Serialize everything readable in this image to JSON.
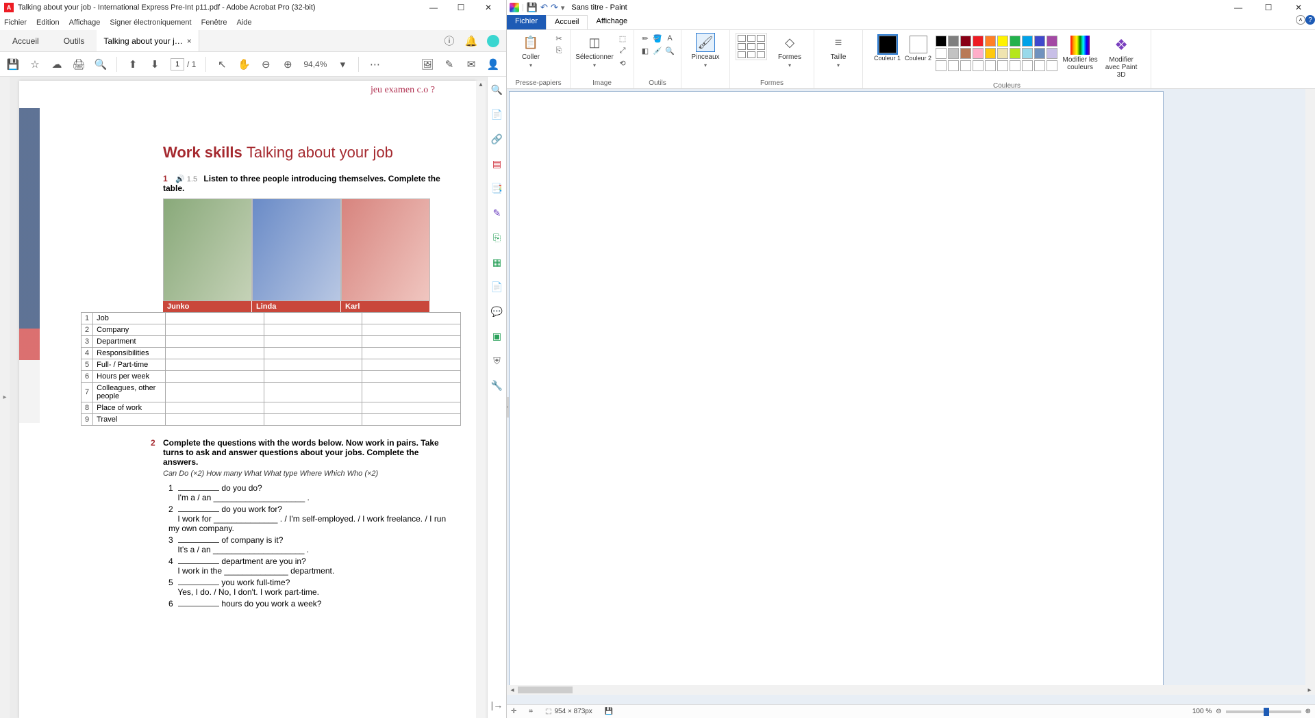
{
  "acrobat": {
    "title": "Talking about your job - International Express Pre-Int p11.pdf - Adobe Acrobat Pro (32-bit)",
    "menu": [
      "Fichier",
      "Edition",
      "Affichage",
      "Signer électroniquement",
      "Fenêtre",
      "Aide"
    ],
    "tabs": {
      "home": "Accueil",
      "tools": "Outils",
      "doc": "Talking about your j…",
      "close": "×"
    },
    "page_current": "1",
    "page_total": "/ 1",
    "zoom": "94,4%",
    "doc": {
      "handnote": "jeu examen  c.o  ?",
      "heading_bold": "Work skills",
      "heading_light": "Talking about your job",
      "ex1_num": "1",
      "ex1_audio": "🔊 1.5",
      "ex1_text": "Listen to three people introducing themselves. Complete the table.",
      "names": [
        "Junko",
        "Linda",
        "Karl"
      ],
      "rows": [
        {
          "n": "1",
          "l": "Job"
        },
        {
          "n": "2",
          "l": "Company"
        },
        {
          "n": "3",
          "l": "Department"
        },
        {
          "n": "4",
          "l": "Responsibilities"
        },
        {
          "n": "5",
          "l": "Full- / Part-time"
        },
        {
          "n": "6",
          "l": "Hours per week"
        },
        {
          "n": "7",
          "l": "Colleagues, other people"
        },
        {
          "n": "8",
          "l": "Place of work"
        },
        {
          "n": "9",
          "l": "Travel"
        }
      ],
      "ex2_num": "2",
      "ex2_text": "Complete the questions with the words below. Now work in pairs. Take turns to ask and answer questions about your jobs. Complete the answers.",
      "wordbank": "Can   Do (×2)   How many   What   What type   Where   Which   Who (×2)",
      "qa": [
        {
          "n": "1",
          "q": " do you do?",
          "a": "I'm a / an ____________________ ."
        },
        {
          "n": "2",
          "q": " do you work for?",
          "a": "I work for ______________ . / I'm self-employed. / I work freelance. / I run my own company."
        },
        {
          "n": "3",
          "q": " of company is it?",
          "a": "It's a / an ____________________ ."
        },
        {
          "n": "4",
          "q": " department are you in?",
          "a": "I work in the ______________ department."
        },
        {
          "n": "5",
          "q": " you work full-time?",
          "a": "Yes, I do. / No, I don't. I work part-time."
        },
        {
          "n": "6",
          "q": " hours do you work a week?",
          "a": ""
        }
      ]
    }
  },
  "paint": {
    "title": "Sans titre - Paint",
    "tabs": {
      "file": "Fichier",
      "home": "Accueil",
      "view": "Affichage"
    },
    "groups": {
      "clipboard": {
        "paste": "Coller",
        "label": "Presse-papiers"
      },
      "image": {
        "select": "Sélectionner",
        "label": "Image"
      },
      "tools": {
        "label": "Outils"
      },
      "brushes": {
        "btn": "Pinceaux"
      },
      "shapes": {
        "btn": "Formes",
        "label": "Formes"
      },
      "size": {
        "btn": "Taille"
      },
      "colors": {
        "c1": "Couleur 1",
        "c2": "Couleur 2",
        "edit": "Modifier les couleurs",
        "p3d": "Modifier avec Paint 3D",
        "label": "Couleurs"
      }
    },
    "palette": [
      "#000",
      "#7f7f7f",
      "#880015",
      "#ed1c24",
      "#ff7f27",
      "#fff200",
      "#22b14c",
      "#00a2e8",
      "#3f48cc",
      "#a349a4",
      "#fff",
      "#c3c3c3",
      "#b97a57",
      "#ffaec9",
      "#ffc90e",
      "#efe4b0",
      "#b5e61d",
      "#99d9ea",
      "#7092be",
      "#c8bfe7",
      "#fff",
      "#fff",
      "#fff",
      "#fff",
      "#fff",
      "#fff",
      "#fff",
      "#fff",
      "#fff",
      "#fff"
    ],
    "status": {
      "cross": "✛",
      "dims_icon": "⌗",
      "dims": "954 × 873px",
      "size_icon": "💾",
      "zoom": "100 %"
    }
  }
}
